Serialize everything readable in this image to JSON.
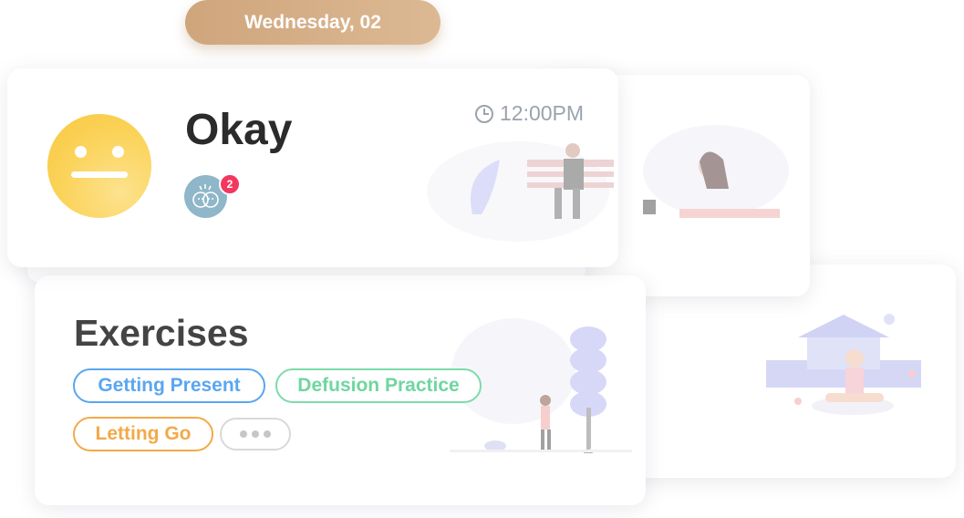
{
  "header": {
    "date_label": "Wednesday, 02"
  },
  "mood_card": {
    "mood_label": "Okay",
    "time": "12:00PM",
    "badge_count": "2",
    "colors": {
      "face": "#fbd35a",
      "badge_bg": "#8fb6c9",
      "badge_count_bg": "#f2385f"
    }
  },
  "exercises_card": {
    "title": "Exercises",
    "tags": [
      {
        "label": "Getting Present",
        "color": "#5aa6f1"
      },
      {
        "label": "Defusion Practice",
        "color": "#6fd6a0"
      },
      {
        "label": "Letting Go",
        "color": "#f3a948"
      }
    ]
  },
  "icons": [
    "clock-icon",
    "baby-face-icon",
    "more-dots-icon"
  ]
}
